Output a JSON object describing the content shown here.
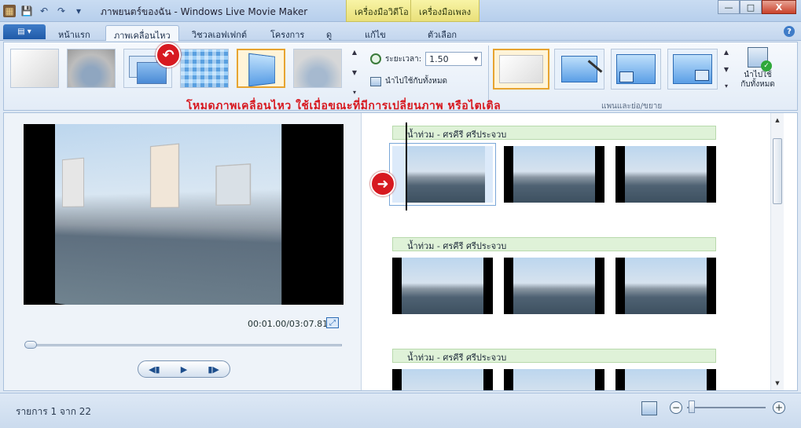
{
  "window": {
    "title": "ภาพยนตร์ของฉัน - Windows Live Movie Maker",
    "context_tabs": [
      "เครื่องมือวิดีโอ",
      "เครื่องมือเพลง"
    ],
    "controls": {
      "minimize": "—",
      "maximize": "□",
      "close": "X"
    }
  },
  "qat": {
    "icons": [
      "app-icon",
      "save-icon",
      "undo-icon",
      "redo-icon",
      "customize-icon"
    ]
  },
  "tabs": {
    "file_menu": "▤ ▾",
    "items": [
      "หน้าแรก",
      "ภาพเคลื่อนไหว",
      "วิชวลเอฟเฟกต์",
      "โครงการ",
      "ดู",
      "แก้ไข",
      "ตัวเลือก"
    ],
    "active": "ภาพเคลื่อนไหว",
    "help": "?"
  },
  "ribbon": {
    "transitions": {
      "duration_label": "ระยะเวลา:",
      "duration_value": "1.50",
      "apply_all_label": "นำไปใช้กับทั้งหมด"
    },
    "pan_zoom": {
      "group_label": "แพนและย่อ/ขยาย",
      "apply_all_label": [
        "นำไปใช้",
        "กับทั้งหมด"
      ]
    },
    "annotation": "โหมดภาพเคลื่อนไหว ใช้เมื่อขณะที่มีการเปลี่ยนภาพ หรือไตเติล"
  },
  "preview": {
    "timecode": "00:01.00/03:07.81",
    "progress": 0.0053
  },
  "storyboard": {
    "groups": [
      {
        "title": "น้ำท่วม - ศรคีรี ศรีประจวบ"
      },
      {
        "title": "น้ำท่วม - ศรคีรี ศรีประจวบ"
      },
      {
        "title": "น้ำท่วม - ศรคีรี ศรีประจวบ"
      }
    ]
  },
  "status": {
    "text": "รายการ 1 จาก 22"
  },
  "colors": {
    "annotation": "#d71920",
    "selected_border": "#e7a431",
    "caption_bg": "#dff2d8"
  }
}
